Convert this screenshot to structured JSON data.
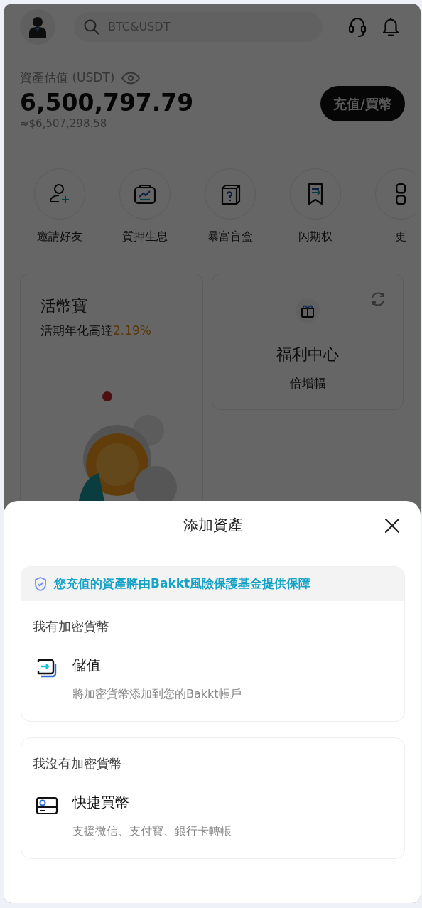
{
  "header": {
    "search": {
      "placeholder": "BTC&USDT"
    }
  },
  "asset": {
    "label": "資產估值 (USDT)",
    "value": "6,500,797.79",
    "approx": "≈$6,507,298.58",
    "button": "充值/買幣"
  },
  "shortcuts": [
    {
      "kind": "invite",
      "label": "邀請好友"
    },
    {
      "kind": "stake",
      "label": "質押生息"
    },
    {
      "kind": "box",
      "label": "暴富盲盒"
    },
    {
      "kind": "flash",
      "label": "闪期权"
    },
    {
      "kind": "more",
      "label": "更"
    }
  ],
  "cards": {
    "savings": {
      "title": "活幣寶",
      "subtitle": "活期年化高達",
      "rate": "2.19%"
    },
    "rewards": {
      "title": "福利中心",
      "subtitle": "倍增幅"
    }
  },
  "sheet": {
    "title": "添加資產",
    "notice": "您充值的資產將由Bakkt風險保護基金提供保障",
    "groups": [
      {
        "heading": "我有加密貨幣",
        "option": {
          "kind": "deposit",
          "title": "儲值",
          "description": "將加密貨幣添加到您的Bakkt帳戶"
        }
      },
      {
        "heading": "我沒有加密貨幣",
        "option": {
          "kind": "buy",
          "title": "快捷買幣",
          "description": "支援微信、支付寶、銀行卡轉帳"
        }
      }
    ]
  }
}
